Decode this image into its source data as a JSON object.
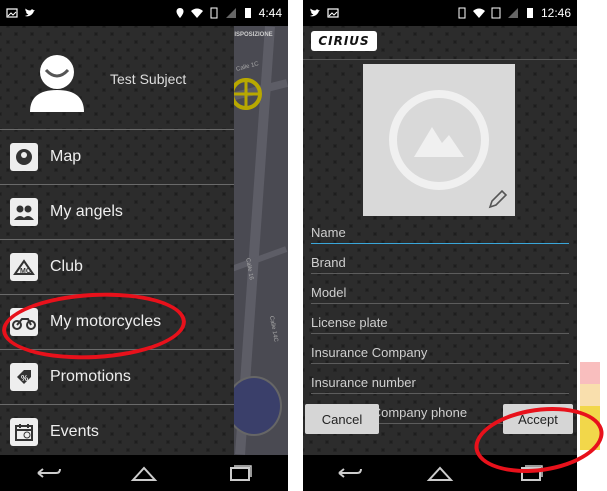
{
  "left": {
    "status": {
      "time": "4:44"
    },
    "profile": {
      "name": "Test Subject"
    },
    "menu": [
      {
        "label": "Map",
        "icon": "map-icon"
      },
      {
        "label": "My angels",
        "icon": "angels-icon"
      },
      {
        "label": "Club",
        "icon": "club-icon"
      },
      {
        "label": "My motorcycles",
        "icon": "motorcycle-icon"
      },
      {
        "label": "Promotions",
        "icon": "promotions-icon"
      },
      {
        "label": "Events",
        "icon": "events-icon"
      }
    ],
    "map_labels": {
      "street_a": "Calle 1C",
      "street_b": "Calle 16",
      "street_c": "Calle 14C",
      "banner": "DISPOSIZIONE"
    }
  },
  "right": {
    "status": {
      "time": "12:46"
    },
    "logo": "CIRIUS",
    "fields": [
      {
        "placeholder": "Name"
      },
      {
        "placeholder": "Brand"
      },
      {
        "placeholder": "Model"
      },
      {
        "placeholder": "License plate"
      },
      {
        "placeholder": "Insurance Company"
      },
      {
        "placeholder": "Insurance number"
      },
      {
        "placeholder": "Insurance Company phone"
      }
    ],
    "buttons": {
      "cancel": "Cancel",
      "accept": "Accept"
    }
  },
  "colors": {
    "highlight": "#e8111b",
    "accent": "#3aa6d9",
    "background": "#1e1e1e"
  }
}
